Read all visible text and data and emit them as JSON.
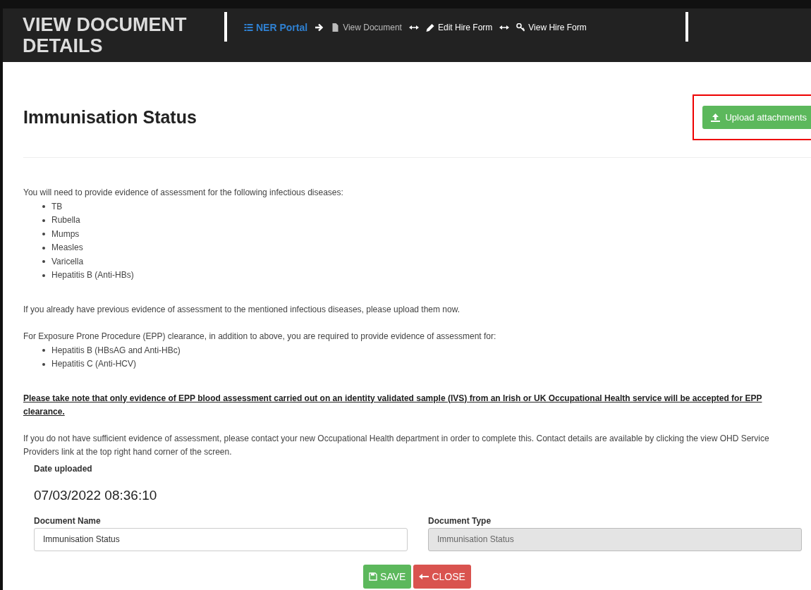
{
  "header": {
    "title": "VIEW DOCUMENT DETAILS",
    "nav": [
      {
        "label": "NER Portal",
        "color": "#2f80d1"
      },
      {
        "label": "View Document",
        "color": "#bbbbbb"
      },
      {
        "label": "Edit Hire Form",
        "color": "#ffffff"
      },
      {
        "label": "View Hire Form",
        "color": "#ffffff"
      }
    ]
  },
  "page_title": "Immunisation Status",
  "upload_button": "Upload attachments",
  "intro": "You will need to provide evidence of assessment for the following infectious diseases:",
  "diseases": [
    "TB",
    "Rubella",
    "Mumps",
    "Measles",
    "Varicella",
    "Hepatitis B (Anti-HBs)"
  ],
  "previous_note": "If you already have previous evidence of assessment to the mentioned infectious diseases, please upload them now.",
  "epp_intro": "For Exposure Prone Procedure (EPP) clearance, in addition to above, you are required to provide evidence of assessment for:",
  "epp_diseases": [
    "Hepatitis B (HBsAG and Anti-HBc)",
    "Hepatitis C (Anti-HCV)"
  ],
  "epp_note": "Please take note that only evidence of EPP blood assessment carried out on an identity validated sample (IVS) from an Irish or UK Occupational Health service will be accepted for EPP clearance.",
  "contact_note": "If you do not have sufficient evidence of assessment, please contact your new Occupational Health department in order to complete this. Contact details are available by clicking the view OHD Service Providers link at the top right hand corner of the screen.",
  "date_label": "Date uploaded",
  "date_value": "07/03/2022 08:36:10",
  "fields": [
    {
      "label": "Document Name",
      "value": "Immunisation Status",
      "disabled": false
    },
    {
      "label": "Document Type",
      "value": "Immunisation Status",
      "disabled": true
    }
  ],
  "buttons": [
    {
      "label": "SAVE",
      "kind": "save"
    },
    {
      "label": "CLOSE",
      "kind": "close"
    }
  ]
}
